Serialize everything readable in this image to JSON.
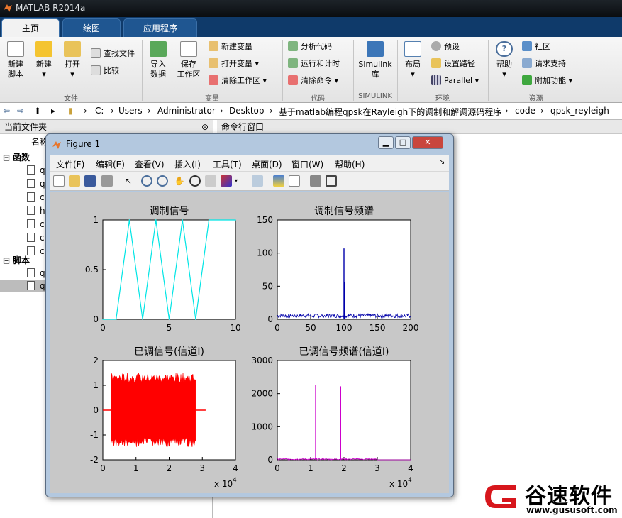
{
  "app": {
    "title": "MATLAB R2014a"
  },
  "tabs": [
    "主页",
    "绘图",
    "应用程序"
  ],
  "ribbon": {
    "new_script": "新建\n脚本",
    "new": "新建",
    "open": "打开",
    "find_files": "查找文件",
    "compare": "比较",
    "import": "导入\n数据",
    "save_ws": "保存\n工作区",
    "new_var": "新建变量",
    "open_var": "打开变量",
    "clear_ws": "清除工作区",
    "analyze": "分析代码",
    "run_time": "运行和计时",
    "clear_cmd": "清除命令",
    "simulink": "Simulink\n库",
    "layout": "布局",
    "prefs": "预设",
    "set_path": "设置路径",
    "parallel": "Parallel",
    "help": "帮助",
    "community": "社区",
    "support": "请求支持",
    "addons": "附加功能",
    "sections": [
      "文件",
      "变量",
      "代码",
      "SIMULINK",
      "环境",
      "资源"
    ]
  },
  "path": [
    "C:",
    "Users",
    "Administrator",
    "Desktop",
    "基于matlab编程qpsk在Rayleigh下的调制和解调源码程序",
    "code",
    "qpsk_reyleigh"
  ],
  "current_folder": {
    "title": "当前文件夹",
    "name_col": "名称",
    "functions_label": "函数",
    "scripts_label": "脚本",
    "func_items": [
      "q",
      "q",
      "c",
      "h",
      "c",
      "c",
      "c"
    ],
    "script_items": [
      "q",
      "q"
    ]
  },
  "command_window": {
    "title": "命令行窗口"
  },
  "figure": {
    "title": "Figure 1",
    "menu": [
      "文件(F)",
      "编辑(E)",
      "查看(V)",
      "插入(I)",
      "工具(T)",
      "桌面(D)",
      "窗口(W)",
      "帮助(H)"
    ]
  },
  "watermark": {
    "brand": "谷速软件",
    "url": "www.gususoft.com"
  },
  "colors": {
    "cyan": "#00e5e5",
    "blue": "#0000aa",
    "red": "#ff0000",
    "magenta": "#cc00cc"
  },
  "chart_data": [
    {
      "type": "line",
      "title": "调制信号",
      "xlim": [
        0,
        10
      ],
      "ylim": [
        0,
        1
      ],
      "xticks": [
        0,
        5,
        10
      ],
      "yticks": [
        0,
        0.5,
        1
      ],
      "x": [
        0,
        1,
        2,
        3,
        4,
        5,
        6,
        7,
        8,
        10
      ],
      "values": [
        0,
        0,
        1,
        0,
        1,
        0,
        1,
        0,
        1,
        1
      ],
      "color": "#00e5e5"
    },
    {
      "type": "line",
      "title": "调制信号频谱",
      "xlim": [
        0,
        200
      ],
      "ylim": [
        0,
        150
      ],
      "xticks": [
        0,
        50,
        100,
        150,
        200
      ],
      "yticks": [
        0,
        50,
        100,
        150
      ],
      "peaks": [
        {
          "x": 100,
          "y": 107
        },
        {
          "x": 101,
          "y": 56
        }
      ],
      "noise_level": 6,
      "color": "#0000aa"
    },
    {
      "type": "area",
      "title": "已调信号(信道I)",
      "xlim": [
        0,
        4
      ],
      "ylim": [
        -2,
        2
      ],
      "xticks": [
        0,
        1,
        2,
        3,
        4
      ],
      "yticks": [
        -2,
        -1,
        0,
        1,
        2
      ],
      "xexp": "x 10^4",
      "band": {
        "start": 0.25,
        "end": 2.8,
        "amp": 1.3
      },
      "color": "#ff0000"
    },
    {
      "type": "line",
      "title": "已调信号频谱(信道I)",
      "xlim": [
        0,
        4
      ],
      "ylim": [
        0,
        3000
      ],
      "xticks": [
        0,
        1,
        2,
        3,
        4
      ],
      "yticks": [
        0,
        1000,
        2000,
        3000
      ],
      "xexp": "x 10^4",
      "peaks": [
        {
          "x": 1.15,
          "y": 2250
        },
        {
          "x": 1.9,
          "y": 2220
        }
      ],
      "noise_level": 40,
      "color": "#cc00cc"
    }
  ]
}
